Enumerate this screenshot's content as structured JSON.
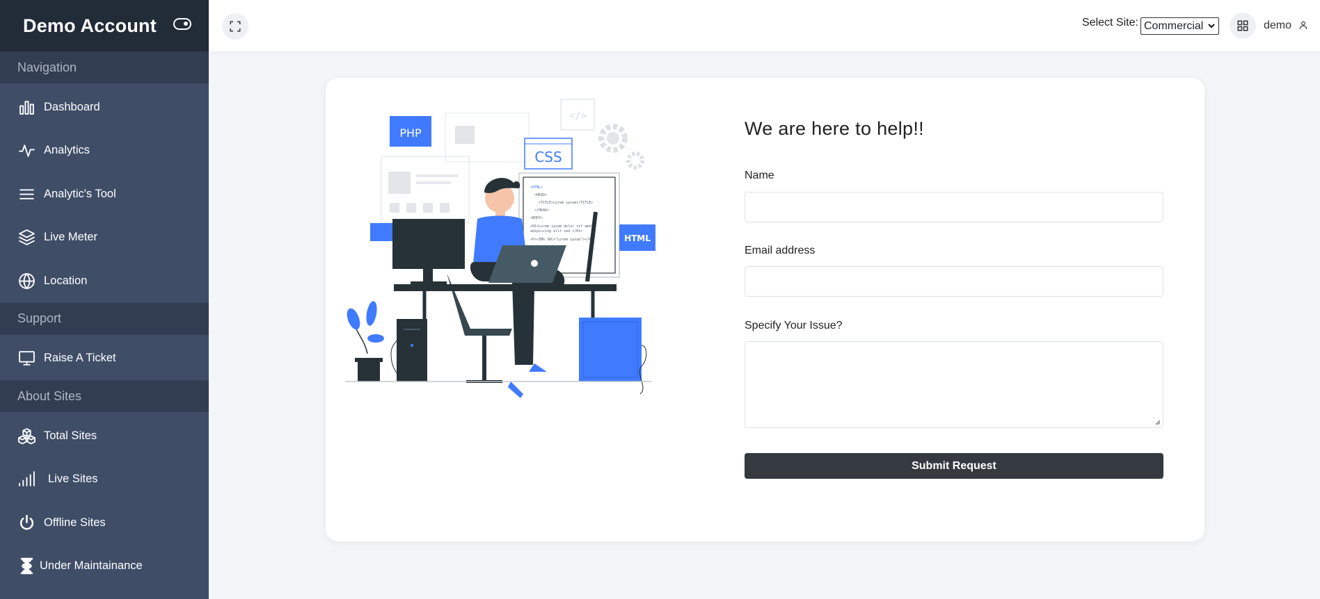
{
  "sidebar": {
    "brand": "Demo Account",
    "sections": [
      {
        "caption": "Navigation",
        "items": [
          {
            "label": "Dashboard",
            "icon": "bar-chart-icon"
          },
          {
            "label": "Analytics",
            "icon": "activity-icon"
          },
          {
            "label": "Analytic's Tool",
            "icon": "menu-icon"
          },
          {
            "label": "Live Meter",
            "icon": "layers-icon"
          },
          {
            "label": "Location",
            "icon": "globe-icon"
          }
        ]
      },
      {
        "caption": "Support",
        "items": [
          {
            "label": "Raise A Ticket",
            "icon": "monitor-icon"
          }
        ]
      },
      {
        "caption": "About Sites",
        "items": [
          {
            "label": "Total Sites",
            "icon": "cubes-icon"
          },
          {
            "label": "Live Sites",
            "icon": "signal-icon"
          },
          {
            "label": "Offline Sites",
            "icon": "power-icon"
          },
          {
            "label": "Under Maintainance",
            "icon": "hourglass-icon"
          }
        ]
      }
    ]
  },
  "header": {
    "site_label": "Select Site:",
    "site_selected": "Commercial",
    "user_name": "demo"
  },
  "form": {
    "title": "We are here to help!!",
    "name_label": "Name",
    "email_label": "Email address",
    "issue_label": "Specify Your Issue?",
    "name_value": "",
    "email_value": "",
    "issue_value": "",
    "submit_label": "Submit Request"
  },
  "illustration": {
    "badges": [
      "PHP",
      "CSS",
      "HTML"
    ]
  },
  "colors": {
    "sidebar_bg": "#3f4d67",
    "brand_bg": "#222b38",
    "caption_bg": "#323d52",
    "accent_blue": "#407bff",
    "button_dark": "#343a40"
  }
}
